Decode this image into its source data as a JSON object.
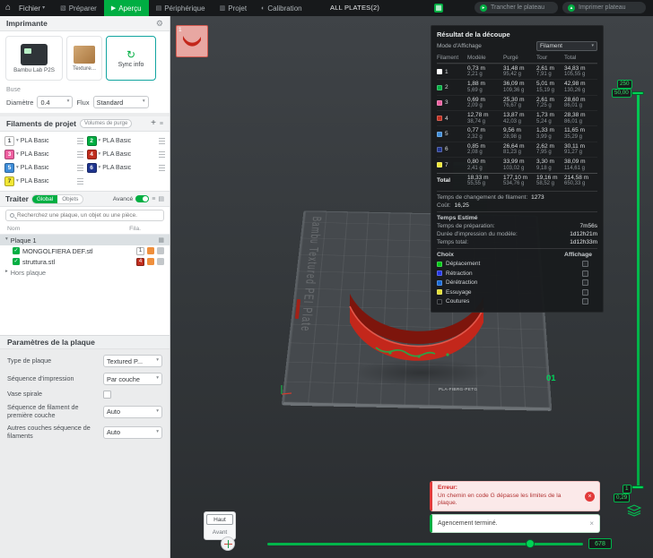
{
  "colors": {
    "accent": "#00ae42",
    "error": "#e23b3b"
  },
  "icons": {
    "home": "⌂",
    "caret_down": "▾",
    "caret_right": "▸",
    "gear": "⚙",
    "plus": "+",
    "menu": "≡",
    "grid": "▦",
    "check": "✓",
    "close": "×",
    "refresh": "↻",
    "play": "▸",
    "up": "▴",
    "layers": "▤",
    "tab_prepare": "▧",
    "tab_preview": "▶",
    "tab_device": "▤",
    "tab_project": "▥",
    "tab_calibration": "◐"
  },
  "topbar": {
    "file_menu": "Fichier",
    "plates_label": "ALL PLATES(2)",
    "slice_button": "Trancher le plateau",
    "print_button": "Imprimer plateau",
    "tabs": [
      {
        "label": "Préparer"
      },
      {
        "label": "Aperçu"
      },
      {
        "label": "Périphérique"
      },
      {
        "label": "Projet"
      },
      {
        "label": "Calibration"
      }
    ]
  },
  "sidebar": {
    "printer": {
      "section": "Imprimante",
      "name": "Bambu Lab P2S",
      "plate_type": "Texture...",
      "sync": "Sync info"
    },
    "nozzle": {
      "label": "Buse",
      "diameter_label": "Diamètre",
      "diameter_value": "0.4",
      "flow_label": "Flux",
      "flow_value": "Standard"
    },
    "filaments": {
      "title": "Filaments de projet",
      "purge_button": "Volumes de purge",
      "items": [
        {
          "num": "1",
          "color": "#ffffff",
          "fg": "#3a3f44",
          "name": "PLA Basic"
        },
        {
          "num": "2",
          "color": "#00ae42",
          "fg": "#ffffff",
          "name": "PLA Basic"
        },
        {
          "num": "3",
          "color": "#ee5f a0",
          "fg": "#ffffff",
          "name": "PLA Basic"
        },
        {
          "num": "4",
          "color": "#c12e1f",
          "fg": "#ffffff",
          "name": "PLA Basic"
        },
        {
          "num": "5",
          "color": "#3f8dd8",
          "fg": "#ffffff",
          "name": "PLA Basic"
        },
        {
          "num": "6",
          "color": "#20368f",
          "fg": "#ffffff",
          "name": "PLA Basic"
        },
        {
          "num": "7",
          "color": "#f2e734",
          "fg": "#4a4a2a",
          "name": "PLA Basic"
        }
      ]
    },
    "process": {
      "title": "Traiter",
      "global": "Global",
      "objects": "Objets",
      "advanced": "Avancé",
      "search_placeholder": "Recherchez une plaque, un objet ou une pièce."
    },
    "tree": {
      "name_col": "Nom",
      "fila_col": "Fila.",
      "plate_row": "Plaque 1",
      "outside_row": "Hors plaque",
      "items": [
        {
          "name": "MONGOLFIERA DEF.stl",
          "fila": "1",
          "color": "#ffffff",
          "fg": "#3a3f44"
        },
        {
          "name": "struttura.stl",
          "fila": "4",
          "color": "#c12e1f",
          "fg": "#ffffff"
        }
      ]
    },
    "plate_settings": {
      "title": "Paramètres de la plaque",
      "type_label": "Type de plaque",
      "type_value": "Textured P...",
      "seq_label": "Séquence d'impression",
      "seq_value": "Par couche",
      "vase_label": "Vase spirale",
      "first_label": "Séquence de filament de première couche",
      "first_value": "Auto",
      "other_label": "Autres couches séquence de filaments",
      "other_value": "Auto"
    }
  },
  "viewport": {
    "thumb_number": "1",
    "plate_name": "Bambu Textured PEI Plate",
    "front_code": "PLA-FIBRG-PETG",
    "slot_label": "01",
    "view_top": "Haut",
    "view_front": "Avant"
  },
  "slice": {
    "title": "Résultat de la découpe",
    "mode_label": "Mode d'Affichage",
    "mode_value": "Filament",
    "headers": [
      "Filament",
      "Modèle",
      "Purgé",
      "Tour",
      "Total"
    ],
    "rows": [
      {
        "num": "1",
        "color": "#ffffff",
        "m1": "0,73 m",
        "g1": "2,21 g",
        "m2": "31,48 m",
        "g2": "95,42 g",
        "m3": "2,61 m",
        "g3": "7,91 g",
        "m4": "34,83 m",
        "g4": "105,55 g"
      },
      {
        "num": "2",
        "color": "#00ae42",
        "m1": "1,88 m",
        "g1": "5,69 g",
        "m2": "36,09 m",
        "g2": "109,36 g",
        "m3": "5,01 m",
        "g3": "15,19 g",
        "m4": "42,98 m",
        "g4": "130,26 g"
      },
      {
        "num": "3",
        "color": "#ee5fa0",
        "m1": "0,69 m",
        "g1": "2,09 g",
        "m2": "25,30 m",
        "g2": "76,67 g",
        "m3": "2,61 m",
        "g3": "7,25 g",
        "m4": "28,60 m",
        "g4": "86,01 g"
      },
      {
        "num": "4",
        "color": "#c12e1f",
        "m1": "12,78 m",
        "g1": "38,74 g",
        "m2": "13,87 m",
        "g2": "42,03 g",
        "m3": "1,73 m",
        "g3": "5,24 g",
        "m4": "28,38 m",
        "g4": "86,01 g"
      },
      {
        "num": "5",
        "color": "#3f8dd8",
        "m1": "0,77 m",
        "g1": "2,32 g",
        "m2": "9,56 m",
        "g2": "28,98 g",
        "m3": "1,33 m",
        "g3": "3,99 g",
        "m4": "11,65 m",
        "g4": "35,29 g"
      },
      {
        "num": "6",
        "color": "#20368f",
        "m1": "0,85 m",
        "g1": "2,08 g",
        "m2": "26,64 m",
        "g2": "81,23 g",
        "m3": "2,62 m",
        "g3": "7,95 g",
        "m4": "30,11 m",
        "g4": "91,27 g"
      },
      {
        "num": "7",
        "color": "#f2e734",
        "m1": "0,80 m",
        "g1": "2,41 g",
        "m2": "33,99 m",
        "g2": "103,02 g",
        "m3": "3,30 m",
        "g3": "9,18 g",
        "m4": "38,09 m",
        "g4": "114,61 g"
      }
    ],
    "total_label": "Total",
    "total": {
      "m1": "18,33 m",
      "g1": "55,55 g",
      "m2": "177,10 m",
      "g2": "534,76 g",
      "m3": "19,16 m",
      "g3": "58,52 g",
      "m4": "214,58 m",
      "g4": "650,33 g"
    },
    "changes_label": "Temps de changement de filament:",
    "changes_value": "1273",
    "cost_label": "Coût:",
    "cost_value": "16,25",
    "time_title": "Temps Estimé",
    "times": [
      {
        "label": "Temps de préparation:",
        "value": "7m56s"
      },
      {
        "label": "Durée d'impression du modèle:",
        "value": "1d12h21m"
      },
      {
        "label": "Temps total:",
        "value": "1d12h33m"
      }
    ],
    "choice_label": "Choix",
    "display_label": "Affichage",
    "options": [
      {
        "label": "Déplacement",
        "color": "#00c814"
      },
      {
        "label": "Rétraction",
        "color": "#2337e6"
      },
      {
        "label": "Dérétraction",
        "color": "#1769d8"
      },
      {
        "label": "Essuyage",
        "color": "#e2de30"
      },
      {
        "label": "Coutures",
        "color": "#15171b"
      }
    ]
  },
  "layer_slider": {
    "top_value": "250",
    "top_height": "50,00",
    "bottom_value": "1",
    "bottom_height": "0,29"
  },
  "timeline": {
    "value": "678"
  },
  "toasts": {
    "error_title": "Erreur:",
    "error_body": "Un chemin en code G dépasse les limites de la plaque.",
    "success_text": "Agencement terminé."
  }
}
